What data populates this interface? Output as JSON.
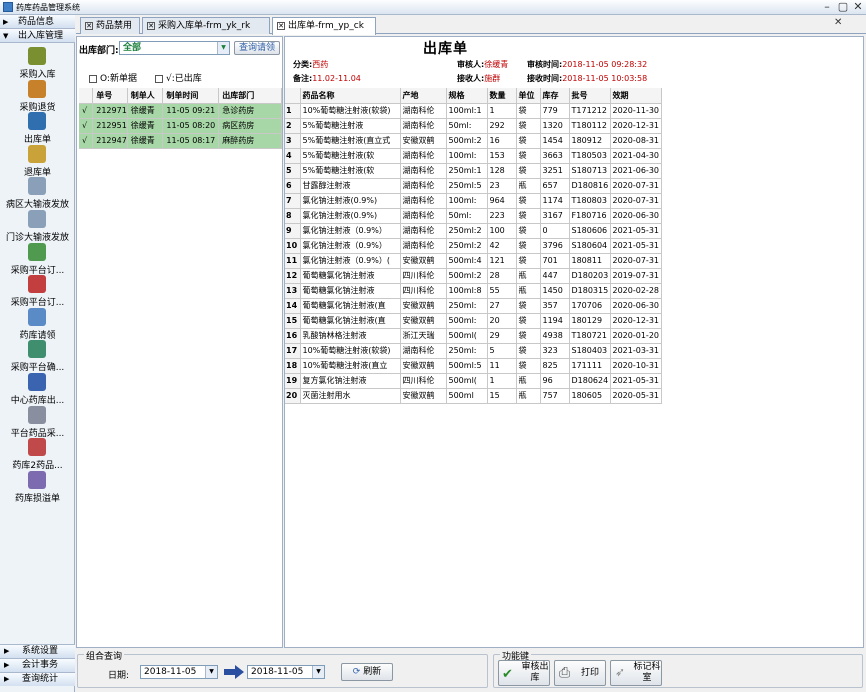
{
  "app": {
    "title": "药库药品管理系统"
  },
  "nav": {
    "sections": [
      {
        "label": "药品信息",
        "expanded": false
      },
      {
        "label": "出入库管理",
        "expanded": true
      }
    ],
    "items": [
      {
        "label": "采购入库",
        "icon": "box-in-icon",
        "color": "#7a8f2f"
      },
      {
        "label": "采购退货",
        "icon": "box-return-icon",
        "color": "#c7812b"
      },
      {
        "label": "出库单",
        "icon": "box-out-icon",
        "color": "#2f6fb0"
      },
      {
        "label": "退库单",
        "icon": "box-back-icon",
        "color": "#c9a23a"
      },
      {
        "label": "病区大输液发放",
        "icon": "iv-bag-icon",
        "color": "#8aa0b8"
      },
      {
        "label": "门诊大输液发放",
        "icon": "iv-bag-icon",
        "color": "#8aa0b8"
      },
      {
        "label": "采购平台订...",
        "icon": "platform-order-icon",
        "color": "#4f9a4f"
      },
      {
        "label": "采购平台订...",
        "icon": "platform-order-icon",
        "color": "#c33f3f"
      },
      {
        "label": "药库请领",
        "icon": "request-icon",
        "color": "#5b8bc7"
      },
      {
        "label": "采购平台确...",
        "icon": "confirm-icon",
        "color": "#3f8f6f"
      },
      {
        "label": "中心药库出...",
        "icon": "bar-chart-icon",
        "color": "#3a64b0"
      },
      {
        "label": "平台药品采...",
        "icon": "purchase-icon",
        "color": "#8a8fa0"
      },
      {
        "label": "药库2药品...",
        "icon": "pie-chart-icon",
        "color": "#c04a4a"
      },
      {
        "label": "药库损溢单",
        "icon": "loss-report-icon",
        "color": "#7d6bb0"
      }
    ],
    "bottom": [
      {
        "label": "系统设置"
      },
      {
        "label": "会计事务"
      },
      {
        "label": "查询统计"
      }
    ]
  },
  "tabs": [
    {
      "label": "药品禁用"
    },
    {
      "label": "采购入库单-frm_yk_rk"
    },
    {
      "label": "出库单-frm_yp_ck"
    }
  ],
  "left": {
    "dept_label": "出库部门:",
    "dept_value": "全部",
    "query_button": "查询请领",
    "check_new": "O:新单据",
    "check_out": "√:已出库",
    "columns": [
      "单号",
      "制单人",
      "制单时间",
      "出库部门"
    ],
    "rows": [
      {
        "mark": "√",
        "no": "212971",
        "maker": "徐缓青",
        "time": "11-05 09:21",
        "dept": "急诊药房"
      },
      {
        "mark": "√",
        "no": "212951",
        "maker": "徐缓青",
        "time": "11-05 08:20",
        "dept": "病区药房"
      },
      {
        "mark": "√",
        "no": "212947",
        "maker": "徐缓青",
        "time": "11-05 08:17",
        "dept": "麻醉药房"
      }
    ]
  },
  "doc": {
    "title": "出库单",
    "category_label": "分类:",
    "category": "西药",
    "note_label": "备注:",
    "note": "11.02-11.04",
    "reviewer_label": "审核人:",
    "reviewer": "徐缓青",
    "review_time_label": "审核时间:",
    "review_time": "2018-11-05 09:28:32",
    "receiver_label": "接收人:",
    "receiver": "施群",
    "receive_time_label": "接收时间:",
    "receive_time": "2018-11-05 10:03:58",
    "columns": [
      "",
      "药品名称",
      "产地",
      "规格",
      "数量",
      "单位",
      "库存",
      "批号",
      "效期"
    ],
    "rows": [
      [
        "1",
        "10%葡萄糖注射液(软袋)",
        "湖南科伦",
        "100ml:1",
        "1",
        "袋",
        "779",
        "T171212",
        "2020-11-30"
      ],
      [
        "2",
        "5%葡萄糖注射液",
        "湖南科伦",
        "50ml:",
        "292",
        "袋",
        "1320",
        "T180112",
        "2020-12-31"
      ],
      [
        "3",
        "5%葡萄糖注射液(直立式",
        "安徽双鹤",
        "500ml:2",
        "16",
        "袋",
        "1454",
        "180912",
        "2020-08-31"
      ],
      [
        "4",
        "5%葡萄糖注射液(软",
        "湖南科伦",
        "100ml:",
        "153",
        "袋",
        "3663",
        "T180503",
        "2021-04-30"
      ],
      [
        "5",
        "5%葡萄糖注射液(软",
        "湖南科伦",
        "250ml:1",
        "128",
        "袋",
        "3251",
        "S180713",
        "2021-06-30"
      ],
      [
        "6",
        "甘露醇注射液",
        "湖南科伦",
        "250ml:5",
        "23",
        "瓶",
        "657",
        "D180816",
        "2020-07-31"
      ],
      [
        "7",
        "氯化钠注射液(0.9%)",
        "湖南科伦",
        "100ml:",
        "964",
        "袋",
        "1174",
        "T180803",
        "2020-07-31"
      ],
      [
        "8",
        "氯化钠注射液(0.9%)",
        "湖南科伦",
        "50ml:",
        "223",
        "袋",
        "3167",
        "F180716",
        "2020-06-30"
      ],
      [
        "9",
        "氯化钠注射液（0.9%）",
        "湖南科伦",
        "250ml:2",
        "100",
        "袋",
        "0",
        "S180606",
        "2021-05-31"
      ],
      [
        "10",
        "氯化钠注射液（0.9%）",
        "湖南科伦",
        "250ml:2",
        "42",
        "袋",
        "3796",
        "S180604",
        "2021-05-31"
      ],
      [
        "11",
        "氯化钠注射液（0.9%）(",
        "安徽双鹤",
        "500ml:4",
        "121",
        "袋",
        "701",
        "180811",
        "2020-07-31"
      ],
      [
        "12",
        "葡萄糖氯化钠注射液",
        "四川科伦",
        "500ml:2",
        "28",
        "瓶",
        "447",
        "D180203",
        "2019-07-31"
      ],
      [
        "13",
        "葡萄糖氯化钠注射液",
        "四川科伦",
        "100ml:8",
        "55",
        "瓶",
        "1450",
        "D180315",
        "2020-02-28"
      ],
      [
        "14",
        "葡萄糖氯化钠注射液(直",
        "安徽双鹤",
        "250ml:",
        "27",
        "袋",
        "357",
        "170706",
        "2020-06-30"
      ],
      [
        "15",
        "葡萄糖氯化钠注射液(直",
        "安徽双鹤",
        "500ml:",
        "20",
        "袋",
        "1194",
        "180129",
        "2020-12-31"
      ],
      [
        "16",
        "乳酸钠林格注射液",
        "浙江天瑞",
        "500ml(",
        "29",
        "袋",
        "4938",
        "T180721",
        "2020-01-20"
      ],
      [
        "17",
        "10%葡萄糖注射液(软袋)",
        "湖南科伦",
        "250ml:",
        "5",
        "袋",
        "323",
        "S180403",
        "2021-03-31"
      ],
      [
        "18",
        "10%葡萄糖注射液(直立",
        "安徽双鹤",
        "500ml:5",
        "11",
        "袋",
        "825",
        "171111",
        "2020-10-31"
      ],
      [
        "19",
        "复方氯化钠注射液",
        "四川科伦",
        "500ml(",
        "1",
        "瓶",
        "96",
        "D180624",
        "2021-05-31"
      ],
      [
        "20",
        "灭菌注射用水",
        "安徽双鹤",
        "500ml",
        "15",
        "瓶",
        "757",
        "180605",
        "2020-05-31"
      ]
    ]
  },
  "filter": {
    "group_label": "组合查询",
    "date_label": "日期:",
    "date_from": "2018-11-05",
    "date_to": "2018-11-05",
    "refresh": "刷新"
  },
  "actions": {
    "group_label": "功能键",
    "review": "审核出库",
    "print": "打印",
    "mark": "标记科室"
  },
  "colors": {
    "selected_row": "#a7d6a7",
    "value_red": "#c00000",
    "accent": "#2f5fa8"
  }
}
